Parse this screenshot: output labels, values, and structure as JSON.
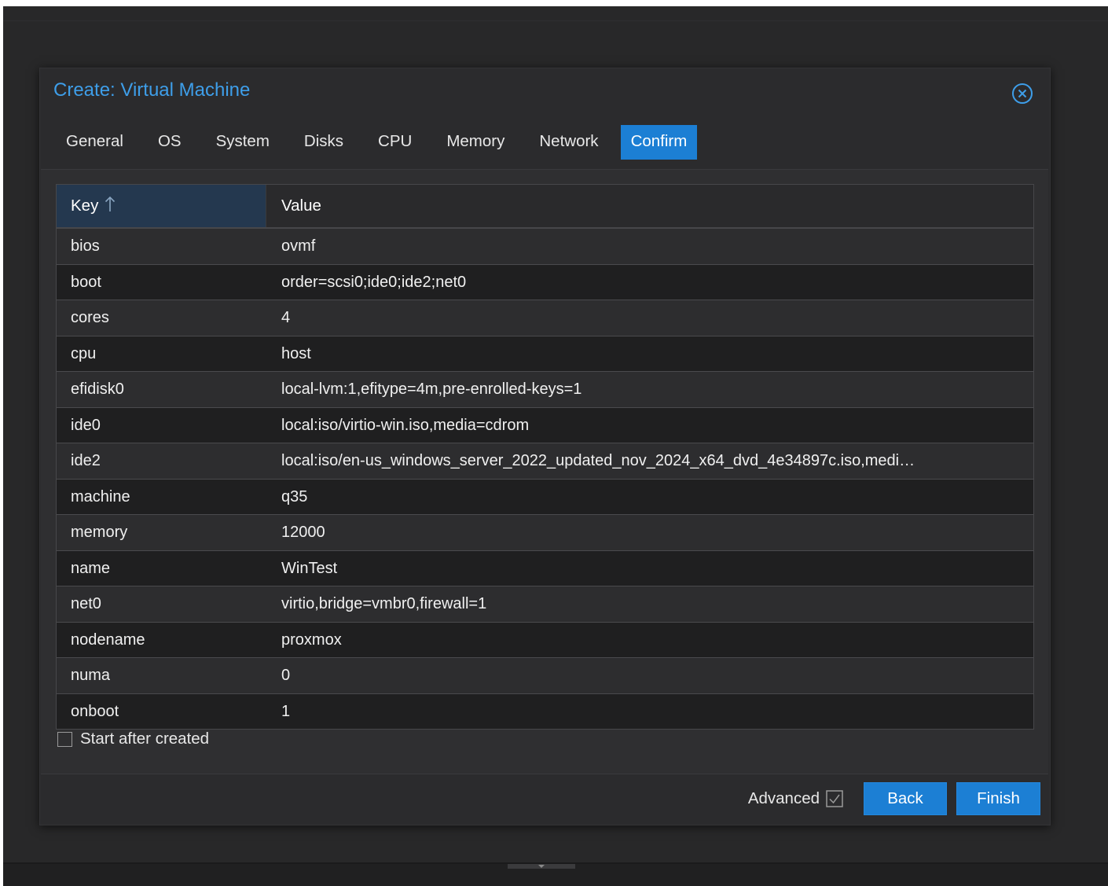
{
  "dialog": {
    "title": "Create: Virtual Machine"
  },
  "tabs": [
    {
      "label": "General"
    },
    {
      "label": "OS"
    },
    {
      "label": "System"
    },
    {
      "label": "Disks"
    },
    {
      "label": "CPU"
    },
    {
      "label": "Memory"
    },
    {
      "label": "Network"
    },
    {
      "label": "Confirm",
      "active": true
    }
  ],
  "grid": {
    "columns": {
      "key": "Key",
      "value": "Value"
    },
    "sort": {
      "column": "Key",
      "direction": "ascending",
      "icon": "arrow-up-icon"
    },
    "rows": [
      {
        "key": "bios",
        "value": "ovmf"
      },
      {
        "key": "boot",
        "value": "order=scsi0;ide0;ide2;net0"
      },
      {
        "key": "cores",
        "value": "4"
      },
      {
        "key": "cpu",
        "value": "host"
      },
      {
        "key": "efidisk0",
        "value": "local-lvm:1,efitype=4m,pre-enrolled-keys=1"
      },
      {
        "key": "ide0",
        "value": "local:iso/virtio-win.iso,media=cdrom"
      },
      {
        "key": "ide2",
        "value": "local:iso/en-us_windows_server_2022_updated_nov_2024_x64_dvd_4e34897c.iso,medi…"
      },
      {
        "key": "machine",
        "value": "q35"
      },
      {
        "key": "memory",
        "value": "12000"
      },
      {
        "key": "name",
        "value": "WinTest"
      },
      {
        "key": "net0",
        "value": "virtio,bridge=vmbr0,firewall=1"
      },
      {
        "key": "nodename",
        "value": "proxmox"
      },
      {
        "key": "numa",
        "value": "0"
      },
      {
        "key": "onboot",
        "value": "1"
      }
    ]
  },
  "options": {
    "start_after_created_label": "Start after created",
    "start_after_created_checked": false
  },
  "footer": {
    "advanced_label": "Advanced",
    "advanced_checked": true,
    "back_label": "Back",
    "finish_label": "Finish"
  },
  "colors": {
    "accent": "#1c7fd4",
    "title": "#3e9ee9",
    "background": "#282829",
    "dialog": "#2b2b2d"
  }
}
